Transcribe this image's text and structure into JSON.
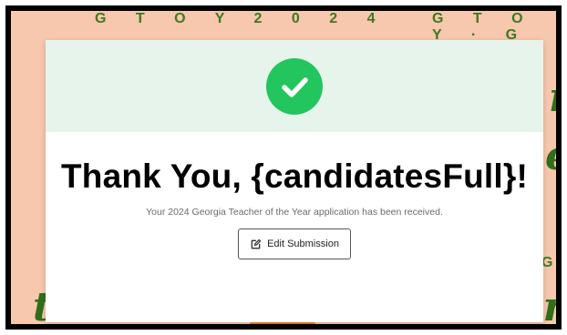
{
  "dialog": {
    "title": "Thank You, {candidatesFull}!",
    "message": "Your 2024 Georgia Teacher of the Year application has been received.",
    "edit_button_label": "Edit Submission",
    "success_icon": "check-circle-icon",
    "edit_icon": "edit-square-icon"
  },
  "colors": {
    "header_bg": "#e6f4ec",
    "success_green": "#22c55e",
    "page_bg": "#f7c7ae",
    "script_green": "#2f6f1a"
  }
}
